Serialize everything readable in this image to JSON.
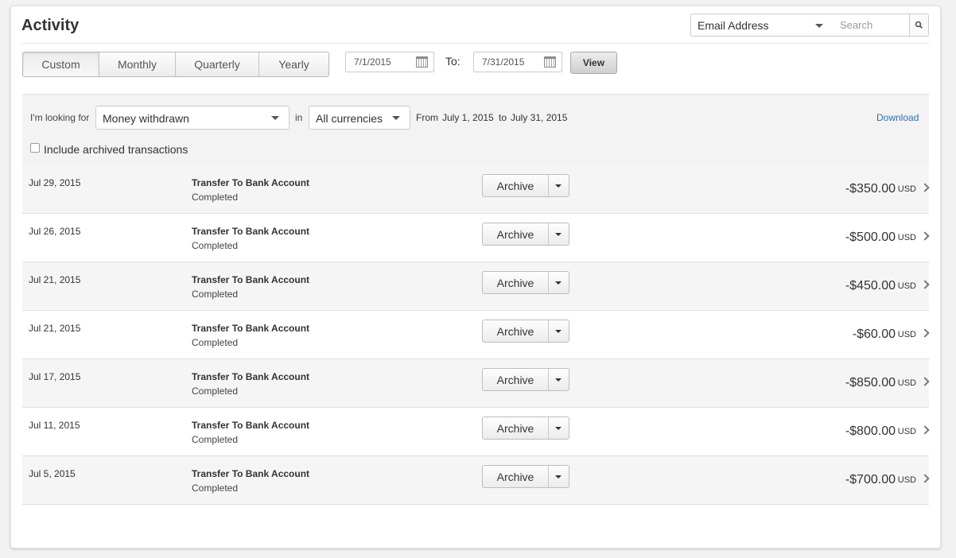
{
  "header": {
    "title": "Activity",
    "search_scope": "Email Address",
    "search_placeholder": "Search"
  },
  "period_tabs": [
    {
      "label": "Custom",
      "active": true
    },
    {
      "label": "Monthly",
      "active": false
    },
    {
      "label": "Quarterly",
      "active": false
    },
    {
      "label": "Yearly",
      "active": false
    }
  ],
  "date_range": {
    "from": "7/1/2015",
    "to_label": "To:",
    "to": "7/31/2015",
    "view_label": "View"
  },
  "filter": {
    "looking_for_label": "I'm looking for",
    "type": "Money withdrawn",
    "in_label": "in",
    "currency": "All currencies",
    "from_label": "From",
    "from_date": "July 1, 2015",
    "to_label": "to",
    "to_date": "July 31, 2015",
    "download_label": "Download",
    "include_archived_label": "Include archived transactions",
    "include_archived": false
  },
  "transactions": [
    {
      "date": "Jul 29, 2015",
      "description": "Transfer To Bank Account",
      "status": "Completed",
      "action": "Archive",
      "amount": "-$350.00",
      "currency": "USD"
    },
    {
      "date": "Jul 26, 2015",
      "description": "Transfer To Bank Account",
      "status": "Completed",
      "action": "Archive",
      "amount": "-$500.00",
      "currency": "USD"
    },
    {
      "date": "Jul 21, 2015",
      "description": "Transfer To Bank Account",
      "status": "Completed",
      "action": "Archive",
      "amount": "-$450.00",
      "currency": "USD"
    },
    {
      "date": "Jul 21, 2015",
      "description": "Transfer To Bank Account",
      "status": "Completed",
      "action": "Archive",
      "amount": "-$60.00",
      "currency": "USD"
    },
    {
      "date": "Jul 17, 2015",
      "description": "Transfer To Bank Account",
      "status": "Completed",
      "action": "Archive",
      "amount": "-$850.00",
      "currency": "USD"
    },
    {
      "date": "Jul 11, 2015",
      "description": "Transfer To Bank Account",
      "status": "Completed",
      "action": "Archive",
      "amount": "-$800.00",
      "currency": "USD"
    },
    {
      "date": "Jul 5, 2015",
      "description": "Transfer To Bank Account",
      "status": "Completed",
      "action": "Archive",
      "amount": "-$700.00",
      "currency": "USD"
    }
  ],
  "icons": {
    "search": "magnifier-icon",
    "calendar": "calendar-icon",
    "dropdown": "chevron-down-icon",
    "row_detail": "chevron-right-icon"
  },
  "colors": {
    "link": "#2a6fb0",
    "filter_band": "#f3f3f3"
  }
}
